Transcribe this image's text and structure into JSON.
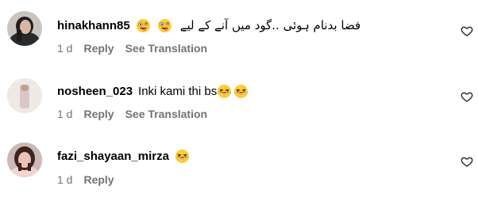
{
  "comments": [
    {
      "username": "hinakhann85",
      "text": "فضا بدنام ہوئی ..گود میں آنے کے لیے",
      "emoji_before_text": [
        "zany-face-emoji",
        "zany-face-emoji"
      ],
      "time": "1 d",
      "reply_label": "Reply",
      "translate_label": "See Translation"
    },
    {
      "username": "nosheen_023",
      "text": "Inki kami thi bs",
      "emoji_after_text": [
        "laughing-face-emoji",
        "laughing-face-emoji"
      ],
      "time": "1 d",
      "reply_label": "Reply",
      "translate_label": "See Translation"
    },
    {
      "username": "fazi_shayaan_mirza",
      "text": "",
      "emoji_after_text": [
        "laughing-face-emoji"
      ],
      "time": "1 d",
      "reply_label": "Reply"
    }
  ],
  "icons": {
    "like": "heart-outline-icon"
  },
  "colors": {
    "secondary_text": "#737373",
    "primary_text": "#000000",
    "emoji_face": "#FFCC33"
  }
}
